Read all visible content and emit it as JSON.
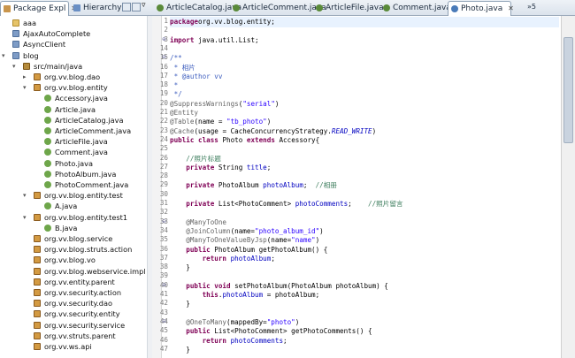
{
  "left_tabs": [
    {
      "label": "Package Expl",
      "icon": "package-explorer-icon",
      "active": true
    },
    {
      "label": "Hierarchy",
      "icon": "hierarchy-icon",
      "active": false
    }
  ],
  "editor_tabs": [
    {
      "label": "ArticleCatalog.java",
      "active": false
    },
    {
      "label": "ArticleComment.java",
      "active": false
    },
    {
      "label": "ArticleFile.java",
      "active": false
    },
    {
      "label": "Comment.java",
      "active": false
    },
    {
      "label": "Photo.java",
      "active": true
    }
  ],
  "overflow_count": "5",
  "tree": [
    {
      "label": "aaa",
      "icon": "folder-icon",
      "indent": 0
    },
    {
      "label": "AjaxAutoComplete",
      "icon": "project-icon",
      "indent": 0
    },
    {
      "label": "AsyncClient",
      "icon": "project-icon",
      "indent": 0
    },
    {
      "label": "blog",
      "icon": "project-icon",
      "indent": 0,
      "expanded": true
    },
    {
      "label": "src/main/java",
      "icon": "source-folder-icon",
      "indent": 1,
      "expanded": true
    },
    {
      "label": "org.vv.blog.dao",
      "icon": "package-icon",
      "indent": 2,
      "collapsed": true
    },
    {
      "label": "org.vv.blog.entity",
      "icon": "package-icon",
      "indent": 2,
      "expanded": true
    },
    {
      "label": "Accessory.java",
      "icon": "java-file-icon",
      "indent": 3
    },
    {
      "label": "Article.java",
      "icon": "java-file-icon",
      "indent": 3
    },
    {
      "label": "ArticleCatalog.java",
      "icon": "java-file-icon",
      "indent": 3
    },
    {
      "label": "ArticleComment.java",
      "icon": "java-file-icon",
      "indent": 3
    },
    {
      "label": "ArticleFile.java",
      "icon": "java-file-icon",
      "indent": 3
    },
    {
      "label": "Comment.java",
      "icon": "java-file-icon",
      "indent": 3
    },
    {
      "label": "Photo.java",
      "icon": "java-file-icon",
      "indent": 3
    },
    {
      "label": "PhotoAlbum.java",
      "icon": "java-file-icon",
      "indent": 3
    },
    {
      "label": "PhotoComment.java",
      "icon": "java-file-icon",
      "indent": 3
    },
    {
      "label": "org.vv.blog.entity.test",
      "icon": "package-icon",
      "indent": 2,
      "expanded": true
    },
    {
      "label": "A.java",
      "icon": "java-file-icon",
      "indent": 3
    },
    {
      "label": "org.vv.blog.entity.test1",
      "icon": "package-icon",
      "indent": 2,
      "expanded": true
    },
    {
      "label": "B.java",
      "icon": "java-file-icon",
      "indent": 3
    },
    {
      "label": "org.vv.blog.service",
      "icon": "package-icon",
      "indent": 2
    },
    {
      "label": "org.vv.blog.struts.action",
      "icon": "package-icon",
      "indent": 2
    },
    {
      "label": "org.vv.blog.vo",
      "icon": "package-icon",
      "indent": 2
    },
    {
      "label": "org.vv.blog.webservice.impl",
      "icon": "package-icon",
      "indent": 2
    },
    {
      "label": "org.vv.entity.parent",
      "icon": "package-icon",
      "indent": 2
    },
    {
      "label": "org.vv.security.action",
      "icon": "package-icon",
      "indent": 2
    },
    {
      "label": "org.vv.security.dao",
      "icon": "package-icon",
      "indent": 2
    },
    {
      "label": "org.vv.security.entity",
      "icon": "package-icon",
      "indent": 2
    },
    {
      "label": "org.vv.security.service",
      "icon": "package-icon",
      "indent": 2
    },
    {
      "label": "org.vv.struts.parent",
      "icon": "package-icon",
      "indent": 2
    },
    {
      "label": "org.vv.ws.api",
      "icon": "package-icon",
      "indent": 2
    }
  ],
  "code_lines": [
    {
      "n": "1",
      "fold": "",
      "segs": [
        [
          "kw",
          "package"
        ],
        [
          "",
          "org.vv.blog.entity;"
        ]
      ]
    },
    {
      "n": "2",
      "fold": "",
      "segs": []
    },
    {
      "n": "3",
      "fold": "⊕",
      "segs": [
        [
          "kw",
          "import"
        ],
        [
          "",
          " java.util.List;"
        ]
      ]
    },
    {
      "n": "14",
      "fold": "",
      "segs": []
    },
    {
      "n": "15",
      "fold": "⊖",
      "segs": [
        [
          "doc",
          "/**"
        ]
      ]
    },
    {
      "n": "16",
      "fold": "",
      "segs": [
        [
          "doc",
          " * 相片"
        ]
      ]
    },
    {
      "n": "17",
      "fold": "",
      "segs": [
        [
          "doc",
          " * @author vv"
        ]
      ]
    },
    {
      "n": "18",
      "fold": "",
      "segs": [
        [
          "doc",
          " *"
        ]
      ]
    },
    {
      "n": "19",
      "fold": "",
      "segs": [
        [
          "doc",
          " */"
        ]
      ]
    },
    {
      "n": "20",
      "fold": "",
      "segs": [
        [
          "ann",
          "@SuppressWarnings"
        ],
        [
          "",
          "("
        ],
        [
          "str",
          "\"serial\""
        ],
        [
          "",
          ")"
        ]
      ]
    },
    {
      "n": "21",
      "fold": "",
      "segs": [
        [
          "ann",
          "@Entity"
        ]
      ]
    },
    {
      "n": "22",
      "fold": "",
      "segs": [
        [
          "ann",
          "@Table"
        ],
        [
          "",
          "(name = "
        ],
        [
          "str",
          "\"tb_photo\""
        ],
        [
          "",
          ")"
        ]
      ]
    },
    {
      "n": "23",
      "fold": "",
      "segs": [
        [
          "ann",
          "@Cache"
        ],
        [
          "",
          "(usage = CacheConcurrencyStrategy."
        ],
        [
          "ital",
          "READ_WRITE"
        ],
        [
          "",
          ")"
        ]
      ]
    },
    {
      "n": "24",
      "fold": "",
      "segs": [
        [
          "kw",
          "public class"
        ],
        [
          "",
          " Photo "
        ],
        [
          "kw",
          "extends"
        ],
        [
          "",
          " Accessory{"
        ]
      ]
    },
    {
      "n": "25",
      "fold": "",
      "segs": []
    },
    {
      "n": "26",
      "fold": "",
      "segs": [
        [
          "cm",
          "    //照片标题"
        ]
      ]
    },
    {
      "n": "27",
      "fold": "",
      "segs": [
        [
          "kw",
          "    private"
        ],
        [
          "",
          " String "
        ],
        [
          "fld",
          "title"
        ],
        [
          "",
          ";"
        ]
      ]
    },
    {
      "n": "28",
      "fold": "",
      "segs": []
    },
    {
      "n": "29",
      "fold": "",
      "segs": [
        [
          "kw",
          "    private"
        ],
        [
          "",
          " PhotoAlbum "
        ],
        [
          "fld",
          "photoAlbum"
        ],
        [
          "",
          ";  "
        ],
        [
          "cm",
          "//相册"
        ]
      ]
    },
    {
      "n": "30",
      "fold": "",
      "segs": []
    },
    {
      "n": "31",
      "fold": "",
      "segs": [
        [
          "kw",
          "    private"
        ],
        [
          "",
          " List<PhotoComment> "
        ],
        [
          "fld",
          "photoComments"
        ],
        [
          "",
          ";    "
        ],
        [
          "cm",
          "//照片留言"
        ]
      ]
    },
    {
      "n": "32",
      "fold": "",
      "segs": []
    },
    {
      "n": "33",
      "fold": "⊖",
      "segs": [
        [
          "ann",
          "    @ManyToOne"
        ]
      ]
    },
    {
      "n": "34",
      "fold": "",
      "segs": [
        [
          "ann",
          "    @JoinColumn"
        ],
        [
          "",
          "(name="
        ],
        [
          "str",
          "\"photo_album_id\""
        ],
        [
          "",
          ")"
        ]
      ]
    },
    {
      "n": "35",
      "fold": "",
      "segs": [
        [
          "ann",
          "    @ManyToOneValueByJsp"
        ],
        [
          "",
          "(name="
        ],
        [
          "str",
          "\"name\""
        ],
        [
          "",
          ")"
        ]
      ]
    },
    {
      "n": "36",
      "fold": "",
      "segs": [
        [
          "kw",
          "    public"
        ],
        [
          "",
          " PhotoAlbum getPhotoAlbum() {"
        ]
      ]
    },
    {
      "n": "37",
      "fold": "",
      "segs": [
        [
          "kw",
          "        return"
        ],
        [
          "",
          " "
        ],
        [
          "fld",
          "photoAlbum"
        ],
        [
          "",
          ";"
        ]
      ]
    },
    {
      "n": "38",
      "fold": "",
      "segs": [
        [
          "",
          "    }"
        ]
      ]
    },
    {
      "n": "39",
      "fold": "",
      "segs": []
    },
    {
      "n": "40",
      "fold": "⊖",
      "segs": [
        [
          "kw",
          "    public void"
        ],
        [
          "",
          " setPhotoAlbum(PhotoAlbum photoAlbum) {"
        ]
      ]
    },
    {
      "n": "41",
      "fold": "",
      "segs": [
        [
          "kw",
          "        this"
        ],
        [
          "",
          "."
        ],
        [
          "fld",
          "photoAlbum"
        ],
        [
          "",
          " = photoAlbum;"
        ]
      ]
    },
    {
      "n": "42",
      "fold": "",
      "segs": [
        [
          "",
          "    }"
        ]
      ]
    },
    {
      "n": "43",
      "fold": "",
      "segs": []
    },
    {
      "n": "44",
      "fold": "⊖",
      "segs": [
        [
          "ann",
          "    @OneToMany"
        ],
        [
          "",
          "(mappedBy="
        ],
        [
          "str",
          "\"photo\""
        ],
        [
          "",
          ")"
        ]
      ]
    },
    {
      "n": "45",
      "fold": "",
      "segs": [
        [
          "kw",
          "    public"
        ],
        [
          "",
          " List<PhotoComment> getPhotoComments() {"
        ]
      ]
    },
    {
      "n": "46",
      "fold": "",
      "segs": [
        [
          "kw",
          "        return"
        ],
        [
          "",
          " "
        ],
        [
          "fld",
          "photoComments"
        ],
        [
          "",
          ";"
        ]
      ]
    },
    {
      "n": "47",
      "fold": "",
      "segs": [
        [
          "",
          "    }"
        ]
      ]
    }
  ]
}
